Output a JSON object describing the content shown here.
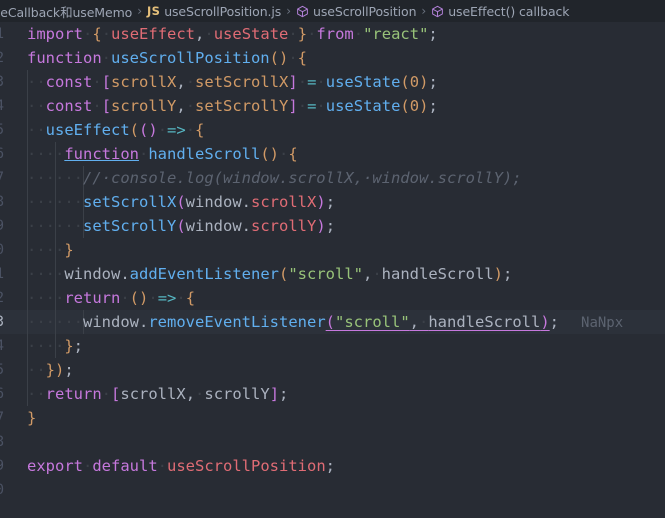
{
  "breadcrumb": {
    "separator": "›",
    "items": [
      {
        "label": "useCallback和useMemo",
        "icon": "none",
        "clipped": true
      },
      {
        "label": "useScrollPosition.js",
        "icon": "js-file-icon",
        "icon_text": "JS"
      },
      {
        "label": "useScrollPosition",
        "icon": "symbol-function-cube-icon"
      },
      {
        "label": "useEffect() callback",
        "icon": "symbol-function-cube-icon"
      }
    ]
  },
  "editor": {
    "language": "javascript",
    "file_name": "useScrollPosition.js",
    "active_line": 13,
    "inlay_hint": "NaNpx",
    "lines": [
      {
        "n": "1",
        "indent": 0
      },
      {
        "n": "2",
        "indent": 0
      },
      {
        "n": "3",
        "indent": 1
      },
      {
        "n": "4",
        "indent": 1
      },
      {
        "n": "5",
        "indent": 1
      },
      {
        "n": "6",
        "indent": 2
      },
      {
        "n": "7",
        "indent": 3
      },
      {
        "n": "8",
        "indent": 3
      },
      {
        "n": "9",
        "indent": 3
      },
      {
        "n": "10",
        "indent": 2
      },
      {
        "n": "11",
        "indent": 2
      },
      {
        "n": "12",
        "indent": 2
      },
      {
        "n": "13",
        "indent": 3
      },
      {
        "n": "14",
        "indent": 2
      },
      {
        "n": "15",
        "indent": 1
      },
      {
        "n": "16",
        "indent": 1
      },
      {
        "n": "17",
        "indent": 0
      },
      {
        "n": "18",
        "indent": 0
      },
      {
        "n": "19",
        "indent": 0
      },
      {
        "n": "20",
        "indent": 0
      }
    ],
    "source_text": [
      "import { useEffect, useState } from \"react\";",
      "function useScrollPosition() {",
      "  const [scrollX, setScrollX] = useState(0);",
      "  const [scrollY, setScrollY] = useState(0);",
      "  useEffect(() => {",
      "    function handleScroll() {",
      "      // console.log(window.scrollX, window.scrollY);",
      "      setScrollX(window.scrollX);",
      "      setScrollY(window.scrollY);",
      "    }",
      "    window.addEventListener(\"scroll\", handleScroll);",
      "    return () => {",
      "      window.removeEventListener(\"scroll\", handleScroll);",
      "    };",
      "  });",
      "  return [scrollX, scrollY];",
      "}",
      "",
      "export default useScrollPosition;",
      ""
    ]
  },
  "colors": {
    "editor_background": "#282c34",
    "breadcrumb_background": "#21252b",
    "active_line_background": "#2c313a",
    "line_number": "#4b5263",
    "indent_guide": "#3b4048",
    "keyword": "#c678dd",
    "function": "#61afef",
    "variable": "#e06c75",
    "string": "#98c379",
    "number": "#d19a66",
    "comment": "#5c6370",
    "object": "#e5c07b",
    "operator": "#56b6c2",
    "foreground": "#abb2bf"
  }
}
